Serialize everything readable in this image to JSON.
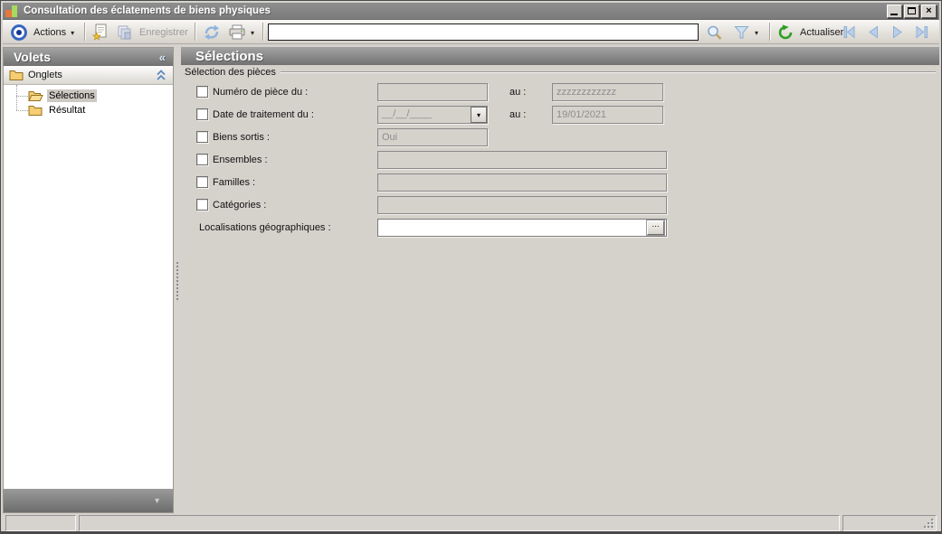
{
  "window": {
    "title": "Consultation des éclatements de biens physiques"
  },
  "toolbar": {
    "actions_label": "Actions",
    "save_label": "Enregistrer",
    "search_value": "",
    "refresh_label": "Actualiser"
  },
  "sidebar": {
    "title": "Volets",
    "section_label": "Onglets",
    "items": [
      {
        "label": "Sélections",
        "selected": true
      },
      {
        "label": "Résultat",
        "selected": false
      }
    ]
  },
  "main": {
    "title": "Sélections",
    "group_label": "Sélection des pièces",
    "fields": {
      "numero": {
        "label": "Numéro de pièce du :",
        "from_value": "",
        "au_label": "au :",
        "to_value": "zzzzzzzzzzzz"
      },
      "date": {
        "label": "Date de traitement du :",
        "from_value": "__/__/____",
        "au_label": "au :",
        "to_value": "19/01/2021"
      },
      "biens": {
        "label": "Biens sortis :",
        "value": "Oui"
      },
      "ensembles": {
        "label": "Ensembles :",
        "value": ""
      },
      "familles": {
        "label": "Familles :",
        "value": ""
      },
      "categories": {
        "label": "Catégories :",
        "value": ""
      },
      "localisations": {
        "label": "Localisations géographiques :",
        "value": "",
        "browse_label": "..."
      }
    }
  },
  "icons": {
    "window_close": "×",
    "dropdown": "▾",
    "sidebar_collapse": "«",
    "panel_collapse_down": "▼"
  },
  "colors": {
    "header_gray": "#8a8a8a",
    "accent_blue": "#3565c0",
    "nav_blue": "#b9cfe9",
    "refresh_green": "#2f9e23",
    "folder_yellow": "#f5cd72",
    "disabled_text": "#8c8c8c",
    "background": "#d5d2cc"
  }
}
